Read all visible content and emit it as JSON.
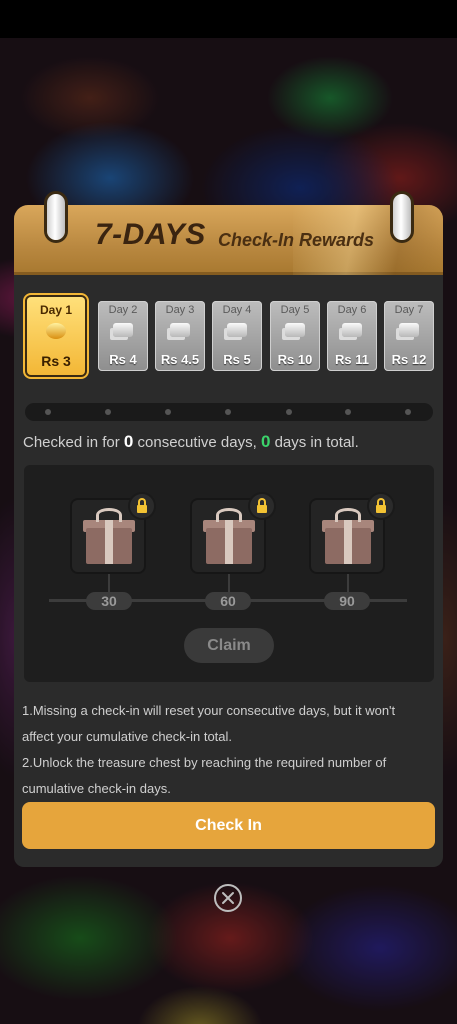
{
  "header": {
    "title_big": "7-DAYS",
    "title_small": "Check-In Rewards"
  },
  "days": [
    {
      "label": "Day 1",
      "value": "Rs 3",
      "active": true
    },
    {
      "label": "Day 2",
      "value": "Rs 4"
    },
    {
      "label": "Day 3",
      "value": "Rs 4.5"
    },
    {
      "label": "Day 4",
      "value": "Rs 5"
    },
    {
      "label": "Day 5",
      "value": "Rs 10"
    },
    {
      "label": "Day 6",
      "value": "Rs 11"
    },
    {
      "label": "Day 7",
      "value": "Rs 12"
    }
  ],
  "status": {
    "prefix": "Checked in for ",
    "consecutive": "0",
    "middle": " consecutive days, ",
    "total": "0",
    "suffix": " days in total."
  },
  "milestones": [
    {
      "label": "30",
      "locked": true
    },
    {
      "label": "60",
      "locked": true
    },
    {
      "label": "90",
      "locked": true
    }
  ],
  "claim_label": "Claim",
  "rules": {
    "line1": "1.Missing a check-in will reset your consecutive days, but it won't affect your cumulative check-in total.",
    "line2": "2.Unlock the treasure chest by reaching the required number of cumulative check-in days."
  },
  "checkin_label": "Check In",
  "colors": {
    "accent": "#e6a53c",
    "header": "#c4934a",
    "green_count": "#3bd36a",
    "lock": "#f2c233"
  },
  "icons": [
    "gift-icon",
    "lock-icon",
    "close-icon",
    "coin-icon"
  ]
}
